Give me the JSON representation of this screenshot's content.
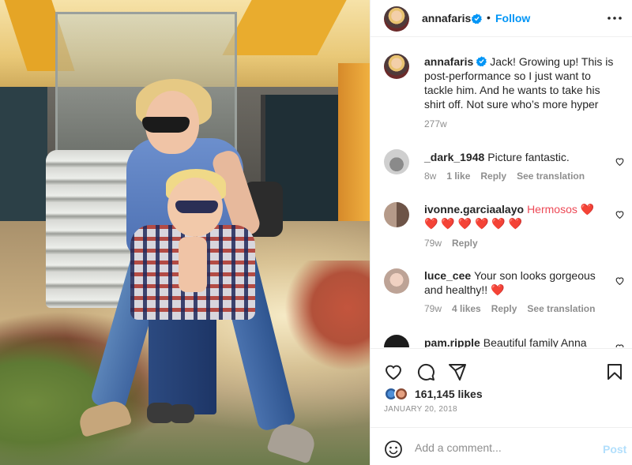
{
  "header": {
    "username": "annafaris",
    "dot": "•",
    "follow_label": "Follow"
  },
  "caption": {
    "username": "annafaris",
    "text": "Jack! Growing up! This is post-performance so I just want to tackle him. And he wants to take his shirt off. Not sure who’s more hyper",
    "time": "277w"
  },
  "comments": [
    {
      "username": "_dark_1948",
      "text": "Picture fantastic.",
      "time": "8w",
      "likes": "1 like",
      "reply": "Reply",
      "translate": "See translation"
    },
    {
      "username": "ivonne.garciaalayo",
      "text": "Hermosos ❤️ ❤️ ❤️ ❤️ ❤️ ❤️ ❤️",
      "time": "79w",
      "reply": "Reply"
    },
    {
      "username": "luce_cee",
      "text": "Your son looks gorgeous and healthy!! ❤️",
      "time": "79w",
      "likes": "4 likes",
      "reply": "Reply",
      "translate": "See translation"
    },
    {
      "username": "pam.ripple",
      "text": "Beautiful family Anna"
    }
  ],
  "actions": {
    "likes": "161,145 likes",
    "date": "JANUARY 20, 2018"
  },
  "add_comment": {
    "placeholder": "Add a comment...",
    "post_label": "Post"
  },
  "colors": {
    "accent": "#0095f6",
    "heart": "#ed4956",
    "muted": "#8e8e8e"
  }
}
